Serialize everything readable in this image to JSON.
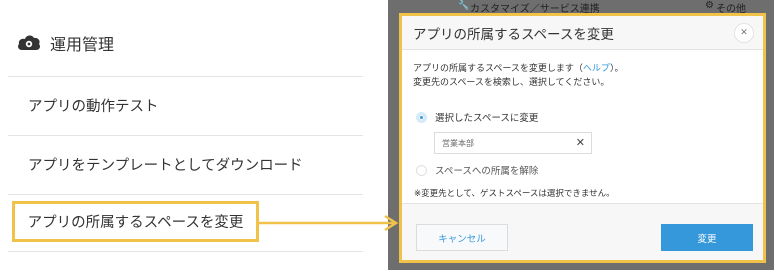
{
  "left_panel": {
    "section_title": "運用管理",
    "section_icon": "cloud-gear-icon",
    "menu": [
      {
        "label": "アプリの動作テスト"
      },
      {
        "label": "アプリをテンプレートとしてダウンロード"
      },
      {
        "label": "アプリの所属するスペースを変更",
        "highlighted": true
      }
    ]
  },
  "background_toolbar": {
    "item1": "カスタマイズ／サービス連携",
    "item2": "その他"
  },
  "dialog": {
    "title": "アプリの所属するスペースを変更",
    "close_icon": "close-icon",
    "description_line1_pre": "アプリの所属するスペースを変更します（",
    "description_help_link": "ヘルプ",
    "description_line1_post": "）。",
    "description_line2": "変更先のスペースを検索し、選択してください。",
    "options": [
      {
        "label": "選択したスペースに変更",
        "selected": true
      },
      {
        "label": "スペースへの所属を解除",
        "selected": false
      }
    ],
    "space_input_value": "営業本部",
    "clear_icon": "clear-icon",
    "note": "※変更先として、ゲストスペースは選択できません。",
    "cancel_label": "キャンセル",
    "submit_label": "変更"
  },
  "colors": {
    "highlight": "#f0c24a",
    "accent": "#3498db",
    "backdrop": "#6e6e6e"
  }
}
